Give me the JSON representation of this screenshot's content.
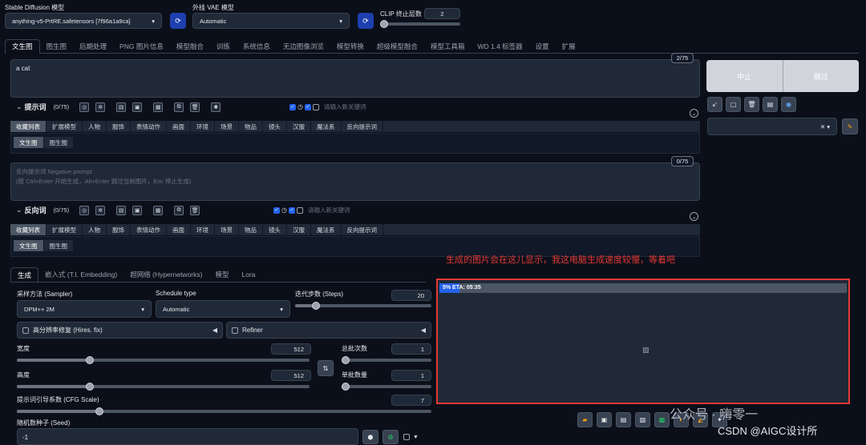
{
  "top": {
    "sd_label": "Stable Diffusion 模型",
    "sd_value": "anything-v5-PrtRE.safetensors [7f96a1a9ca]",
    "vae_label": "外挂 VAE 模型",
    "vae_value": "Automatic",
    "clip_label": "CLIP 终止层数",
    "clip_value": "2"
  },
  "main_tabs": [
    "文生图",
    "图生图",
    "后期处理",
    "PNG 图片信息",
    "模型融合",
    "训练",
    "系统信息",
    "无边图像浏览",
    "模型转换",
    "超级模型融合",
    "模型工具箱",
    "WD 1.4 标签器",
    "设置",
    "扩展"
  ],
  "prompt": {
    "text": "a cat",
    "counter": "2/75",
    "label": "提示词",
    "count": "(0/75)",
    "keyword_placeholder": "请输入新关键词"
  },
  "category_tabs": [
    "收藏列表",
    "扩展模型",
    "人物",
    "服饰",
    "表情动作",
    "画面",
    "环境",
    "场景",
    "物品",
    "镜头",
    "汉服",
    "魔法系",
    "反向提示词"
  ],
  "sub_tabs": [
    "文生图",
    "图生图"
  ],
  "negative": {
    "placeholder": "反向提示词 Negative prompt\n(按 Ctrl+Enter 开始生成，Alt+Enter 跳过当前图片，Esc 停止生成)",
    "counter": "0/75",
    "label": "反向词",
    "count": "(0/75)",
    "keyword_placeholder": "请输入新关键词"
  },
  "actions": {
    "interrupt": "中止",
    "skip": "跳过"
  },
  "gen_tabs": [
    "生成",
    "嵌入式 (T.I. Embedding)",
    "超网络 (Hypernetworks)",
    "模型",
    "Lora"
  ],
  "params": {
    "sampler_label": "采样方法 (Sampler)",
    "sampler_value": "DPM++ 2M",
    "schedule_label": "Schedule type",
    "schedule_value": "Automatic",
    "steps_label": "迭代步数 (Steps)",
    "steps_value": "20",
    "hires_label": "高分辨率修复 (Hires. fix)",
    "refiner_label": "Refiner",
    "width_label": "宽度",
    "width_value": "512",
    "height_label": "高度",
    "height_value": "512",
    "batch_count_label": "总批次数",
    "batch_count_value": "1",
    "batch_size_label": "单批数量",
    "batch_size_value": "1",
    "cfg_label": "提示词引导系数 (CFG Scale)",
    "cfg_value": "7",
    "seed_label": "随机数种子 (Seed)",
    "seed_value": "-1"
  },
  "levels": {
    "steps": 0.15,
    "width": 0.25,
    "height": 0.25,
    "batch_count": 0.0,
    "batch_size": 0.0,
    "cfg": 0.2
  },
  "output": {
    "progress_text": "5% ETA: 05:35",
    "progress": 0.05,
    "annotation": "生成的图片会在这儿显示，我这电脑生成速度较慢，等着吧",
    "annotation_color": "#e53935"
  },
  "watermark": {
    "line1": "公众号 · 嗨零一",
    "line2": "CSDN @AIGC设计所"
  }
}
